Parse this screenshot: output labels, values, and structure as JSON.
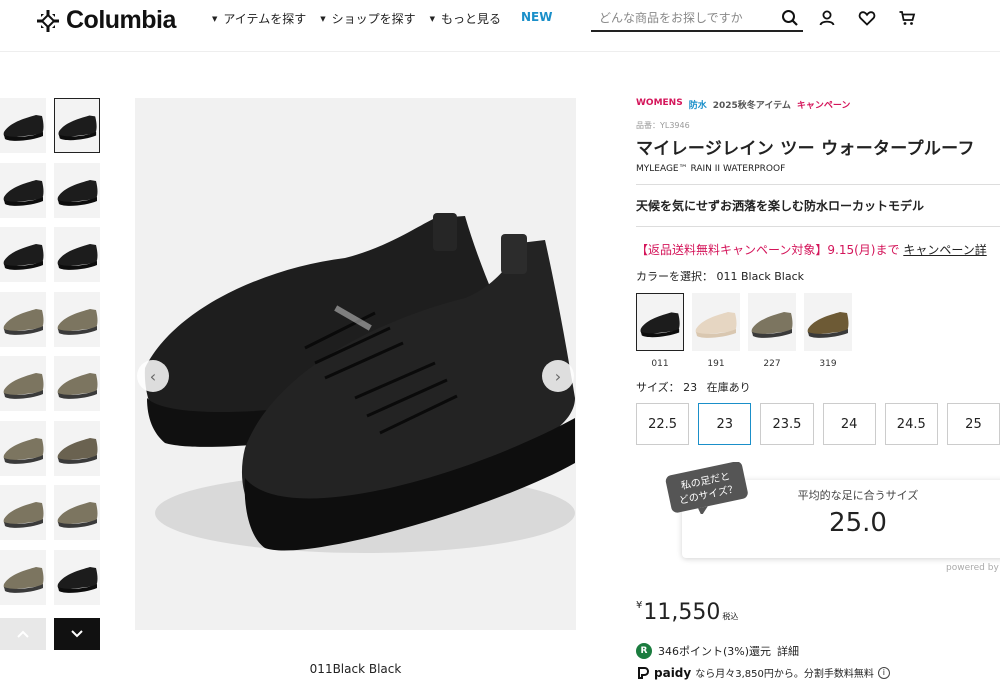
{
  "header": {
    "brand": "Columbia",
    "nav": [
      {
        "label": "アイテムを探す"
      },
      {
        "label": "ショップを探す"
      },
      {
        "label": "もっと見る"
      }
    ],
    "new_label": "NEW",
    "search_placeholder": "どんな商品をお探しですか",
    "icons": [
      "search-icon",
      "user-icon",
      "heart-icon",
      "cart-icon"
    ]
  },
  "gallery": {
    "caption": "011Black Black",
    "thumb_count": 16
  },
  "product": {
    "tags": [
      "WOMENS",
      "防水",
      "2025秋冬アイテム",
      "キャンペーン"
    ],
    "sku": "品番：YL3946",
    "title": "マイレージレイン ツー ウォータープルーフ",
    "subtitle": "MYLEAGE™ RAIN II WATERPROOF",
    "catch": "天候を気にせずお洒落を楽しむ防水ローカットモデル",
    "campaign_text": "【返品送料無料キャンペーン対象】9.15(月)まで",
    "campaign_link": "キャンペーン詳",
    "color_label": "カラーを選択：",
    "color_selected": "011 Black Black",
    "colors": [
      {
        "code": "011",
        "color": "#1c1c1c"
      },
      {
        "code": "191",
        "color": "#e6d6c2"
      },
      {
        "code": "227",
        "color": "#7c7560"
      },
      {
        "code": "319",
        "color": "#6d5a35"
      }
    ],
    "size_label": "サイズ：",
    "size_selected": "23",
    "stock": "在庫あり",
    "sizes": [
      "22.5",
      "23",
      "23.5",
      "24",
      "24.5",
      "25"
    ],
    "fit_bubble": "私の足だと\nどのサイズ？",
    "fit_label": "平均的な足に合うサイズ",
    "fit_value": "25.0",
    "powered": "powered by",
    "price_yen": "¥",
    "price": "11,550",
    "tax": "税込",
    "points_icon": "R",
    "points": "346ポイント(3%)還元",
    "points_detail": "詳細",
    "paidy_brand": "paidy",
    "paidy_text": "なら月々3,850円から。分割手数料無料"
  }
}
